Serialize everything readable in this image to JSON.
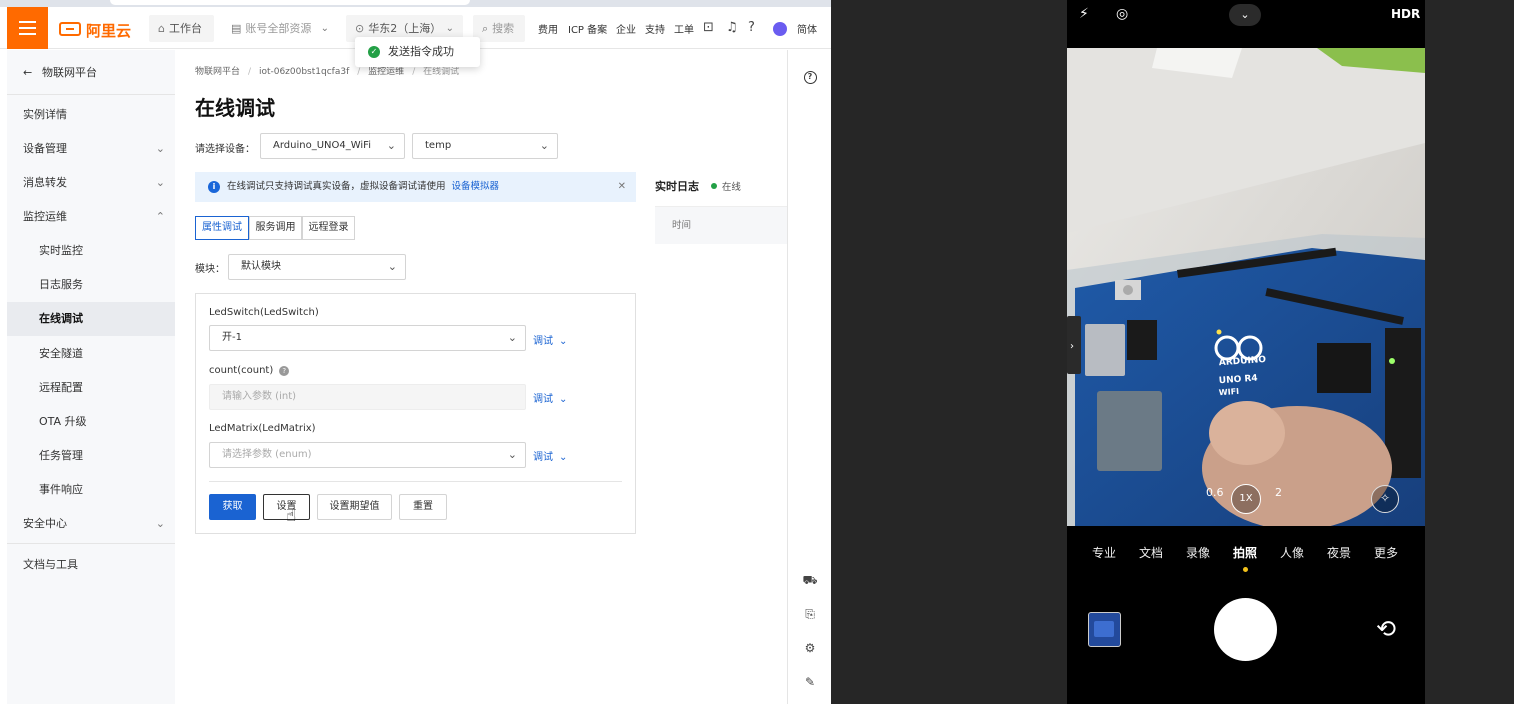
{
  "topbar": {
    "logo": "阿里云",
    "workbench": "工作台",
    "account_resources": "账号全部资源",
    "region": "华东2（上海）",
    "search_placeholder": "搜索",
    "links": [
      "费用",
      "ICP 备案",
      "企业",
      "支持",
      "工单"
    ],
    "lang": "简体"
  },
  "toast": {
    "text": "发送指令成功"
  },
  "sidebar": {
    "back": "物联网平台",
    "items": [
      {
        "label": "实例详情"
      },
      {
        "label": "设备管理",
        "expand": "down"
      },
      {
        "label": "消息转发",
        "expand": "down"
      },
      {
        "label": "监控运维",
        "expand": "up"
      },
      {
        "label": "实时监控"
      },
      {
        "label": "日志服务"
      },
      {
        "label": "在线调试",
        "active": true
      },
      {
        "label": "安全隧道"
      },
      {
        "label": "远程配置"
      },
      {
        "label": "OTA 升级"
      },
      {
        "label": "任务管理"
      },
      {
        "label": "事件响应"
      },
      {
        "label": "安全中心",
        "expand": "down"
      },
      {
        "label": "文档与工具"
      }
    ]
  },
  "breadcrumb": [
    "物联网平台",
    "iot-06z00bst1qcfa3f",
    "监控运维",
    "在线调试"
  ],
  "page": {
    "title": "在线调试",
    "device_label": "请选择设备：",
    "product": "Arduino_UNO4_WiFi",
    "device": "temp",
    "notice": "在线调试只支持调试真实设备，虚拟设备调试请使用",
    "notice_link": "设备模拟器",
    "tabs": [
      "属性调试",
      "服务调用",
      "远程登录"
    ],
    "module_label": "模块：",
    "module_value": "默认模块",
    "props": [
      {
        "name": "LedSwitch(LedSwitch)",
        "value": "开-1",
        "action": "调试"
      },
      {
        "name": "count(count)",
        "placeholder": "请输入参数 (int)",
        "action": "调试"
      },
      {
        "name": "LedMatrix(LedMatrix)",
        "placeholder": "请选择参数 (enum)",
        "action": "调试"
      }
    ],
    "buttons": [
      "获取",
      "设置",
      "设置期望值",
      "重置"
    ],
    "log_title": "实时日志",
    "log_status": "在线",
    "log_col": "时间"
  },
  "phone": {
    "hdr": "HDR",
    "zoom": [
      "0.6",
      "1X",
      "2"
    ],
    "modes": [
      "专业",
      "文档",
      "录像",
      "拍照",
      "人像",
      "夜景",
      "更多"
    ],
    "active_mode": "拍照",
    "board_brand": "ARDUINO",
    "board_model": "UNO R4",
    "board_wifi": "WIFI"
  },
  "colors": {
    "brand": "#ff6a00",
    "primary": "#1a63d2",
    "success": "#23a046"
  }
}
